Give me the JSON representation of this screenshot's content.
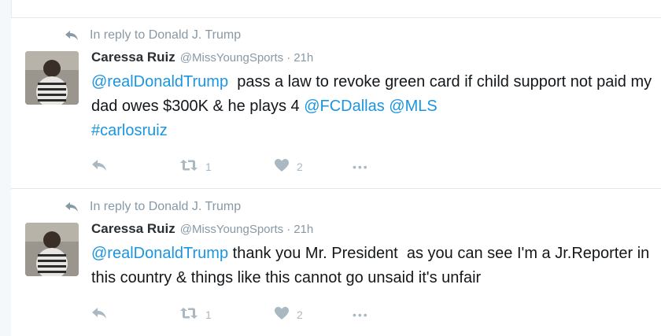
{
  "tweets": [
    {
      "reply_context": "In reply to Donald J. Trump",
      "author_name": "Caressa Ruiz",
      "handle": "@MissYoungSports",
      "separator": "·",
      "time": "21h",
      "text_parts": {
        "mention": "@realDonaldTrump",
        "body_1": "  pass a law to revoke green card if child support not paid my dad owes $300K & he plays 4 ",
        "mention_2": "@FCDallas",
        "space_1": " ",
        "mention_3": "@MLS",
        "space_2": " ",
        "hashtag": "#carlosruiz"
      },
      "retweet_count": "1",
      "like_count": "2",
      "more": "•••"
    },
    {
      "reply_context": "In reply to Donald J. Trump",
      "author_name": "Caressa Ruiz",
      "handle": "@MissYoungSports",
      "separator": "·",
      "time": "21h",
      "text_parts": {
        "mention": "@realDonaldTrump",
        "body_1": " thank you Mr. President  as you can see I'm a Jr.Reporter in this country & things like this cannot go unsaid it's unfair"
      },
      "retweet_count": "1",
      "like_count": "2",
      "more": "•••"
    }
  ],
  "colors": {
    "link": "#1b95e0",
    "muted": "#8899a6",
    "action_gray": "#aab8c2",
    "divider": "#e1e8ed"
  },
  "icons": [
    "reply-context-arrow-icon",
    "reply-icon",
    "retweet-icon",
    "like-heart-icon",
    "more-options-icon"
  ]
}
